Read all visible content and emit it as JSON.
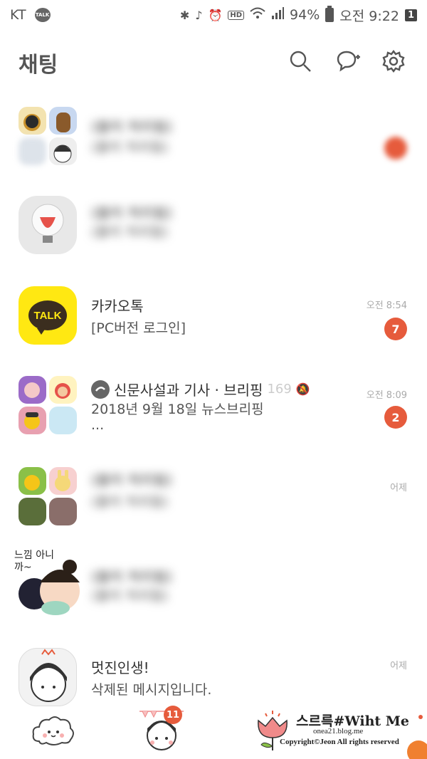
{
  "status_bar": {
    "carrier": "KT",
    "talk_icon_label": "TALK",
    "battery": "94%",
    "clock": "오전 9:22",
    "notification_count": "1",
    "hd_label": "HD"
  },
  "header": {
    "title": "채팅"
  },
  "chats": [
    {
      "name": "(블러 처리됨)",
      "preview": "(블러 처리됨)",
      "time": "",
      "unread": ""
    },
    {
      "name": "(블러 처리됨)",
      "preview": "(블러 처리됨)",
      "time": "",
      "unread": ""
    },
    {
      "name": "카카오톡",
      "preview": "[PC버전 로그인]",
      "time": "오전 8:54",
      "unread": "7",
      "logo_text": "TALK"
    },
    {
      "name": "신문사설과 기사 · 브리핑",
      "member_count": "169",
      "preview_line1": "2018년  9월  18일 뉴스브리핑",
      "preview_line2": "...",
      "time": "오전 8:09",
      "unread": "2"
    },
    {
      "name": "(블러 처리됨)",
      "preview": "(블러 처리됨)",
      "time": "어제",
      "unread": ""
    },
    {
      "name": "(블러 처리됨)",
      "preview": "(블러 처리됨)",
      "avatar_caption": "느낌 아니까~",
      "time": "",
      "unread": ""
    },
    {
      "name": "멋진인생!",
      "preview": "삭제된 메시지입니다.",
      "time": "어제",
      "unread": ""
    }
  ],
  "tabbar": {
    "chat_badge": "11"
  },
  "watermark": {
    "title": "스르륵#Wiht Me",
    "site": "onea21.blog.me",
    "copyright": "Copyright©Jeon All rights reserved"
  },
  "colors": {
    "unread_badge": "#e65b3c",
    "kakao_yellow": "#ffe812",
    "kakao_brown": "#3b2e1f"
  }
}
